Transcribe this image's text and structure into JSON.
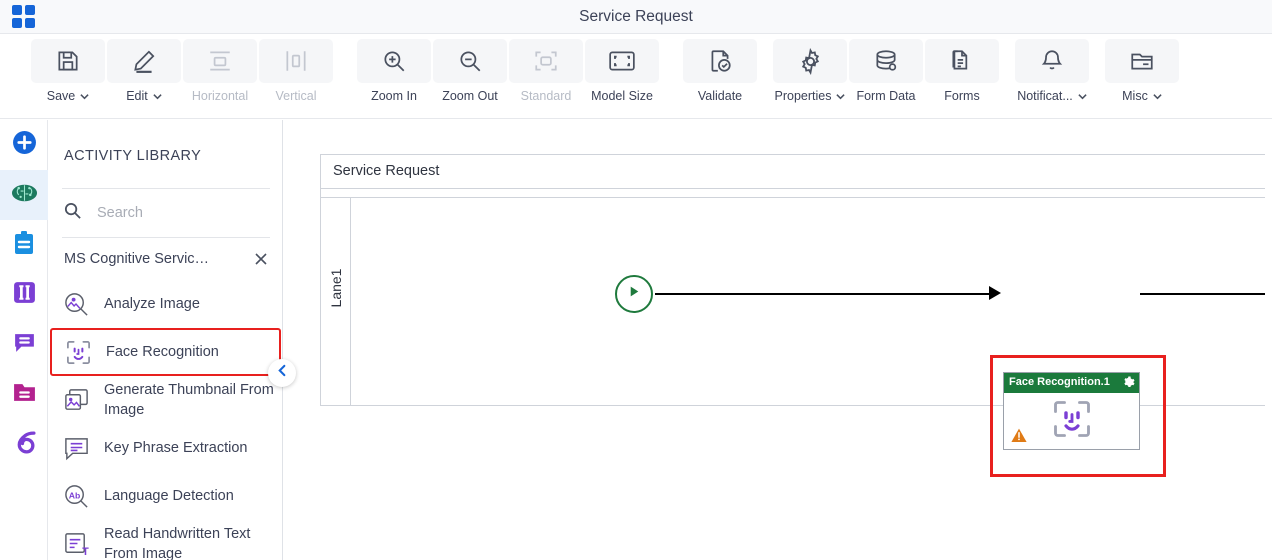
{
  "titlebar": {
    "title": "Service Request",
    "app_launcher_icon": "app-grid-icon"
  },
  "ribbon": {
    "buttons": [
      {
        "label": "Save",
        "icon": "save-icon",
        "caret": true,
        "disabled": false
      },
      {
        "label": "Edit",
        "icon": "pencil-icon",
        "caret": true,
        "disabled": false
      },
      {
        "label": "Horizontal",
        "icon": "horizontal-icon",
        "caret": false,
        "disabled": true
      },
      {
        "label": "Vertical",
        "icon": "vertical-icon",
        "caret": false,
        "disabled": true
      },
      {
        "label": "Zoom In",
        "icon": "zoom-in-icon",
        "caret": false,
        "disabled": false
      },
      {
        "label": "Zoom Out",
        "icon": "zoom-out-icon",
        "caret": false,
        "disabled": false
      },
      {
        "label": "Standard",
        "icon": "standard-size-icon",
        "caret": false,
        "disabled": true
      },
      {
        "label": "Model Size",
        "icon": "model-size-icon",
        "caret": false,
        "disabled": false
      },
      {
        "label": "Validate",
        "icon": "validate-icon",
        "caret": false,
        "disabled": false
      },
      {
        "label": "Properties",
        "icon": "gear-icon",
        "caret": true,
        "disabled": false
      },
      {
        "label": "Form Data",
        "icon": "database-icon",
        "caret": false,
        "disabled": false
      },
      {
        "label": "Forms",
        "icon": "forms-icon",
        "caret": false,
        "disabled": false
      },
      {
        "label": "Notificat...",
        "icon": "bell-icon",
        "caret": true,
        "disabled": false
      },
      {
        "label": "Misc",
        "icon": "folder-icon",
        "caret": true,
        "disabled": false
      }
    ]
  },
  "rail": {
    "items": [
      {
        "name": "add-button",
        "icon": "plus-circle-icon",
        "color": "#1565d8",
        "active": false
      },
      {
        "name": "cognitive-services",
        "icon": "brain-icon",
        "color": "#1d7a5f",
        "active": true
      },
      {
        "name": "tasks",
        "icon": "clipboard-icon",
        "color": "#1a8fe0",
        "active": false
      },
      {
        "name": "columns",
        "icon": "columns-icon",
        "color": "#7b3fd4",
        "active": false
      },
      {
        "name": "messages",
        "icon": "chat-icon",
        "color": "#7b3fd4",
        "active": false
      },
      {
        "name": "documents",
        "icon": "folder-lines-icon",
        "color": "#b3228f",
        "active": false
      },
      {
        "name": "integrations",
        "icon": "swirl-icon",
        "color": "#7b3fd4",
        "active": false
      }
    ]
  },
  "library": {
    "title": "ACTIVITY LIBRARY",
    "search": {
      "placeholder": "Search",
      "value": "",
      "icon": "search-icon"
    },
    "category": {
      "label": "MS Cognitive Servic…",
      "close_icon": "close-icon"
    },
    "activities": [
      {
        "label": "Analyze Image",
        "icon": "analyze-image-icon",
        "selected": false
      },
      {
        "label": "Face Recognition",
        "icon": "face-recognition-icon",
        "selected": true
      },
      {
        "label": "Generate Thumbnail From Image",
        "icon": "thumbnail-icon",
        "selected": false
      },
      {
        "label": "Key Phrase Extraction",
        "icon": "key-phrase-icon",
        "selected": false
      },
      {
        "label": "Language Detection",
        "icon": "language-detect-icon",
        "selected": false
      },
      {
        "label": "Read Handwritten Text From Image",
        "icon": "handwritten-text-icon",
        "selected": false
      }
    ],
    "collapse_handle_icon": "chevron-left-icon"
  },
  "canvas": {
    "pool_title": "Service Request",
    "lane_label": "Lane1",
    "start_event": {
      "name": "start-event",
      "icon": "play-icon",
      "color": "#1f7a3d"
    },
    "end_event": {
      "name": "end-event",
      "icon": "stop-icon",
      "color": "#c0322f"
    },
    "task": {
      "title": "Face Recognition.1",
      "header_color": "#1b7a3c",
      "gear_icon": "gear-icon",
      "body_icon": "face-recognition-icon",
      "warning_icon": "warning-icon",
      "selected": true,
      "selection_color": "#e8201e"
    }
  }
}
